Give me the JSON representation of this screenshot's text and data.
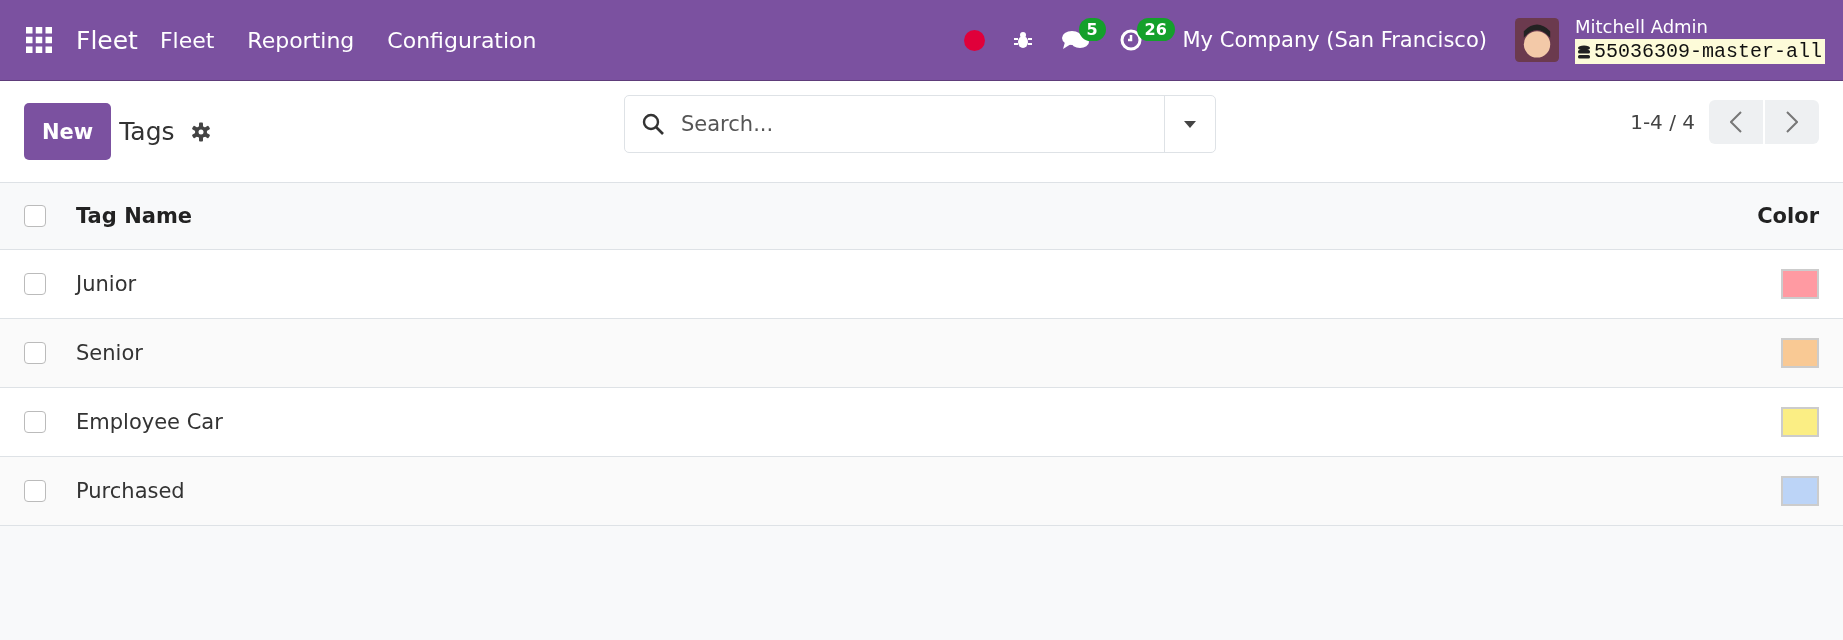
{
  "navbar": {
    "app_name": "Fleet",
    "menu": [
      {
        "label": "Fleet"
      },
      {
        "label": "Reporting"
      },
      {
        "label": "Configuration"
      }
    ],
    "messages_count": "5",
    "activities_count": "26",
    "company": "My Company (San Francisco)",
    "user_name": "Mitchell Admin",
    "database": "55036309-master-all"
  },
  "control_panel": {
    "new_button": "New",
    "title": "Tags",
    "search": {
      "placeholder": "Search..."
    },
    "pager": "1-4 / 4"
  },
  "table": {
    "select_all_checked": false,
    "columns": [
      "Tag Name",
      "Color"
    ],
    "rows": [
      {
        "name": "Junior",
        "color": "#ff9aa2",
        "checked": false
      },
      {
        "name": "Senior",
        "color": "#f9c994",
        "checked": false
      },
      {
        "name": "Employee Car",
        "color": "#fbee84",
        "checked": false
      },
      {
        "name": "Purchased",
        "color": "#bcd4f7",
        "checked": false
      }
    ]
  }
}
